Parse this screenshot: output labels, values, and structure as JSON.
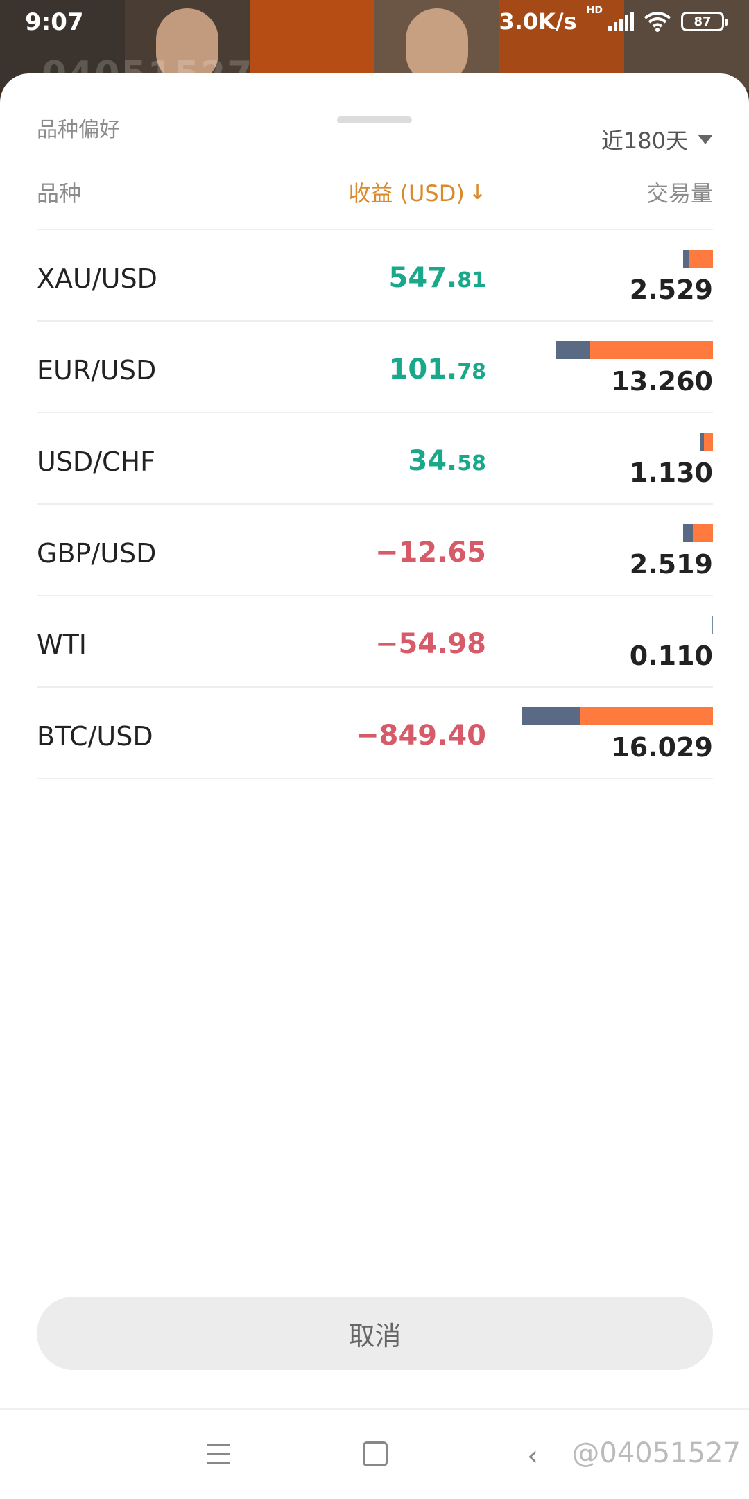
{
  "status_bar": {
    "time": "9:07",
    "network_speed": "3.0K/s",
    "hd_label": "HD",
    "battery_level": "87"
  },
  "background": {
    "ghost_text": "04051527"
  },
  "sheet": {
    "title": "品种偏好",
    "period_label": "近180天",
    "headers": {
      "instrument": "品种",
      "profit": "收益 (USD)",
      "profit_sort_icon": "↓",
      "volume": "交易量"
    },
    "rows": [
      {
        "instrument": "XAU/USD",
        "profit_int": "547.",
        "profit_dec": "81",
        "sign": "pos",
        "volume": "2.529",
        "volume_value": 2.529,
        "buy_share": 0.2
      },
      {
        "instrument": "EUR/USD",
        "profit_int": "101.",
        "profit_dec": "78",
        "sign": "pos",
        "volume": "13.260",
        "volume_value": 13.26,
        "buy_share": 0.22
      },
      {
        "instrument": "USD/CHF",
        "profit_int": "34.",
        "profit_dec": "58",
        "sign": "pos",
        "volume": "1.130",
        "volume_value": 1.13,
        "buy_share": 0.3
      },
      {
        "instrument": "GBP/USD",
        "profit_int": "−12.65",
        "profit_dec": "",
        "sign": "neg",
        "volume": "2.519",
        "volume_value": 2.519,
        "buy_share": 0.33
      },
      {
        "instrument": "WTI",
        "profit_int": "−54.98",
        "profit_dec": "",
        "sign": "neg",
        "volume": "0.110",
        "volume_value": 0.11,
        "buy_share": 1.0
      },
      {
        "instrument": "BTC/USD",
        "profit_int": "−849.40",
        "profit_dec": "",
        "sign": "neg",
        "volume": "16.029",
        "volume_value": 16.029,
        "buy_share": 0.3
      }
    ],
    "cancel_label": "取消"
  },
  "nav_bar": {
    "watermark": "@04051527"
  },
  "colors": {
    "positive": "#1aa88a",
    "negative": "#d65a68",
    "accent": "#d98a2a",
    "buy_bar": "#5a6a85",
    "sell_bar": "#ff7a3f"
  }
}
